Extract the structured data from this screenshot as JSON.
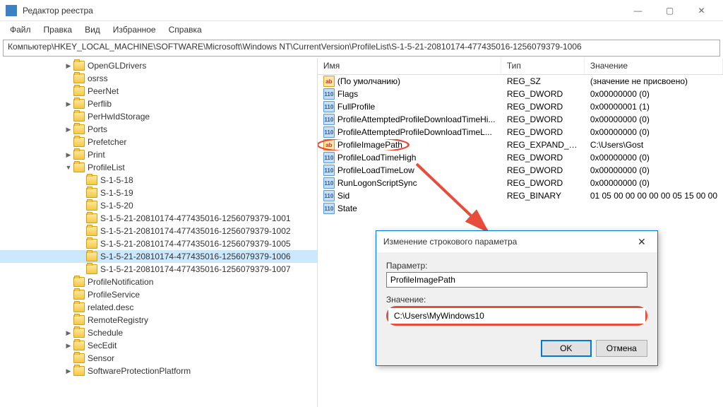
{
  "window": {
    "title": "Редактор реестра",
    "min": "—",
    "max": "▢",
    "close": "✕"
  },
  "menu": {
    "file": "Файл",
    "edit": "Правка",
    "view": "Вид",
    "favorites": "Избранное",
    "help": "Справка"
  },
  "path": "Компьютер\\HKEY_LOCAL_MACHINE\\SOFTWARE\\Microsoft\\Windows NT\\CurrentVersion\\ProfileList\\S-1-5-21-20810174-477435016-1256079379-1006",
  "tree": [
    {
      "indent": 5,
      "twist": ">",
      "label": "OpenGLDrivers"
    },
    {
      "indent": 5,
      "twist": "",
      "label": "osrss"
    },
    {
      "indent": 5,
      "twist": "",
      "label": "PeerNet"
    },
    {
      "indent": 5,
      "twist": ">",
      "label": "Perflib"
    },
    {
      "indent": 5,
      "twist": "",
      "label": "PerHwIdStorage"
    },
    {
      "indent": 5,
      "twist": ">",
      "label": "Ports"
    },
    {
      "indent": 5,
      "twist": "",
      "label": "Prefetcher"
    },
    {
      "indent": 5,
      "twist": ">",
      "label": "Print"
    },
    {
      "indent": 5,
      "twist": "v",
      "label": "ProfileList"
    },
    {
      "indent": 6,
      "twist": "",
      "label": "S-1-5-18"
    },
    {
      "indent": 6,
      "twist": "",
      "label": "S-1-5-19"
    },
    {
      "indent": 6,
      "twist": "",
      "label": "S-1-5-20"
    },
    {
      "indent": 6,
      "twist": "",
      "label": "S-1-5-21-20810174-477435016-1256079379-1001"
    },
    {
      "indent": 6,
      "twist": "",
      "label": "S-1-5-21-20810174-477435016-1256079379-1002"
    },
    {
      "indent": 6,
      "twist": "",
      "label": "S-1-5-21-20810174-477435016-1256079379-1005"
    },
    {
      "indent": 6,
      "twist": "",
      "label": "S-1-5-21-20810174-477435016-1256079379-1006",
      "selected": true
    },
    {
      "indent": 6,
      "twist": "",
      "label": "S-1-5-21-20810174-477435016-1256079379-1007"
    },
    {
      "indent": 5,
      "twist": "",
      "label": "ProfileNotification"
    },
    {
      "indent": 5,
      "twist": "",
      "label": "ProfileService"
    },
    {
      "indent": 5,
      "twist": "",
      "label": "related.desc"
    },
    {
      "indent": 5,
      "twist": "",
      "label": "RemoteRegistry"
    },
    {
      "indent": 5,
      "twist": ">",
      "label": "Schedule"
    },
    {
      "indent": 5,
      "twist": ">",
      "label": "SecEdit"
    },
    {
      "indent": 5,
      "twist": "",
      "label": "Sensor"
    },
    {
      "indent": 5,
      "twist": ">",
      "label": "SoftwareProtectionPlatform"
    }
  ],
  "list": {
    "headers": {
      "name": "Имя",
      "type": "Тип",
      "value": "Значение"
    },
    "rows": [
      {
        "icon": "str",
        "name": "(По умолчанию)",
        "type": "REG_SZ",
        "value": "(значение не присвоено)"
      },
      {
        "icon": "bin",
        "name": "Flags",
        "type": "REG_DWORD",
        "value": "0x00000000 (0)"
      },
      {
        "icon": "bin",
        "name": "FullProfile",
        "type": "REG_DWORD",
        "value": "0x00000001 (1)"
      },
      {
        "icon": "bin",
        "name": "ProfileAttemptedProfileDownloadTimeHi...",
        "type": "REG_DWORD",
        "value": "0x00000000 (0)"
      },
      {
        "icon": "bin",
        "name": "ProfileAttemptedProfileDownloadTimeL...",
        "type": "REG_DWORD",
        "value": "0x00000000 (0)"
      },
      {
        "icon": "str",
        "name": "ProfileImagePath",
        "type": "REG_EXPAND_SZ",
        "value": "C:\\Users\\Gost",
        "circled": true
      },
      {
        "icon": "bin",
        "name": "ProfileLoadTimeHigh",
        "type": "REG_DWORD",
        "value": "0x00000000 (0)"
      },
      {
        "icon": "bin",
        "name": "ProfileLoadTimeLow",
        "type": "REG_DWORD",
        "value": "0x00000000 (0)"
      },
      {
        "icon": "bin",
        "name": "RunLogonScriptSync",
        "type": "REG_DWORD",
        "value": "0x00000000 (0)"
      },
      {
        "icon": "bin",
        "name": "Sid",
        "type": "REG_BINARY",
        "value": "01 05 00 00 00 00 00 05 15 00 00"
      },
      {
        "icon": "bin",
        "name": "State",
        "type": "",
        "value": ""
      }
    ]
  },
  "dialog": {
    "title": "Изменение строкового параметра",
    "param_label": "Параметр:",
    "param_value": "ProfileImagePath",
    "value_label": "Значение:",
    "value_value": "C:\\Users\\MyWindows10",
    "ok": "OK",
    "cancel": "Отмена"
  }
}
